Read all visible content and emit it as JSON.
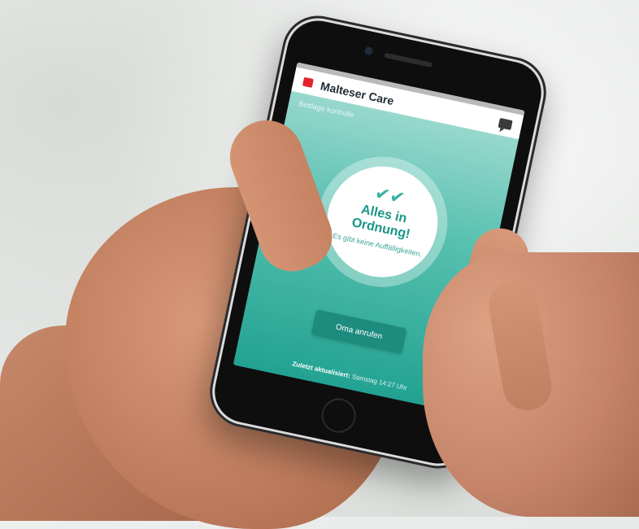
{
  "app": {
    "brand": "Malteser Care",
    "subtitle": "Bettlage kontrolle",
    "status": {
      "title_line1": "Alles in",
      "title_line2": "Ordnung!",
      "message": "Es gibt keine Auffälligkeiten."
    },
    "call_button_label": "Oma anrufen",
    "footer_bold": "Zuletzt aktualisiert:",
    "footer_time": "Samstag 14:27 Uhr"
  },
  "icons": {
    "logo": "malteser-logo-icon",
    "chat": "chat-icon",
    "check": "double-check-icon"
  },
  "colors": {
    "accent": "#1e8b7f",
    "brand_red": "#e1242b",
    "screen_top": "#a9ded5",
    "screen_bottom": "#22a292"
  }
}
